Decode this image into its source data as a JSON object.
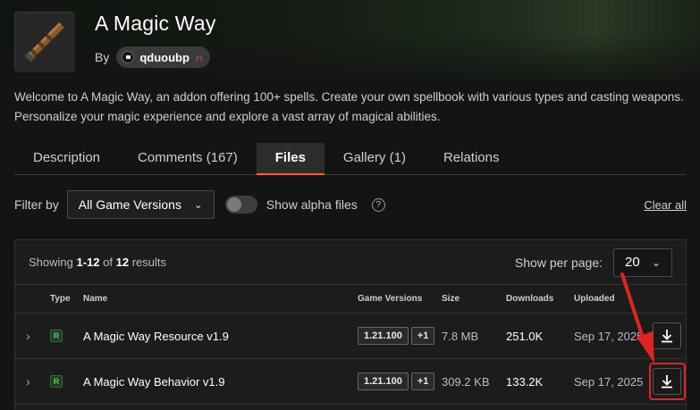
{
  "header": {
    "title": "A Magic Way",
    "by_label": "By",
    "author": "qduoubp",
    "author_badge_icon": "horseshoe-icon",
    "avatar_icon": "wand-icon"
  },
  "summary": "Welcome to A Magic Way, an addon offering 100+ spells. Create your own spellbook with various types and casting weapons. Personalize your magic experience and explore a vast array of magical abilities.",
  "tabs": [
    {
      "label": "Description",
      "active": false
    },
    {
      "label": "Comments (167)",
      "active": false
    },
    {
      "label": "Files",
      "active": true
    },
    {
      "label": "Gallery (1)",
      "active": false
    },
    {
      "label": "Relations",
      "active": false
    }
  ],
  "filters": {
    "filter_by_label": "Filter by",
    "game_version_value": "All Game Versions",
    "alpha_label": "Show alpha files",
    "alpha_enabled": false,
    "clear_all": "Clear all"
  },
  "results": {
    "showing_prefix": "Showing",
    "range": "1-12",
    "of": "of",
    "total": "12",
    "suffix": "results",
    "per_page_label": "Show per page:",
    "per_page_value": "20"
  },
  "table": {
    "headers": [
      "Type",
      "Name",
      "Game Versions",
      "Size",
      "Downloads",
      "Uploaded"
    ],
    "rows": [
      {
        "type": "R",
        "name": "A Magic Way Resource v1.9",
        "version": "1.21.100",
        "extra_versions": "+1",
        "size": "7.8 MB",
        "downloads": "251.0K",
        "uploaded": "Sep 17, 2025"
      },
      {
        "type": "R",
        "name": "A Magic Way Behavior v1.9",
        "version": "1.21.100",
        "extra_versions": "+1",
        "size": "309.2 KB",
        "downloads": "133.2K",
        "uploaded": "Sep 17, 2025"
      }
    ]
  },
  "colors": {
    "accent": "#f16436",
    "highlight": "#e02424",
    "type_badge": "#61c46b"
  }
}
